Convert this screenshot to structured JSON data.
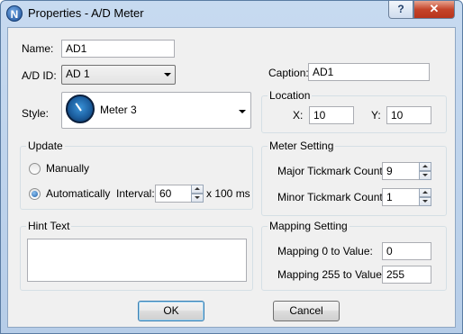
{
  "window": {
    "title": "Properties - A/D Meter",
    "app_icon_letter": "N",
    "help_label": "?",
    "close_label": "✕"
  },
  "name": {
    "label": "Name:",
    "value": "AD1"
  },
  "ad_id": {
    "label": "A/D ID:",
    "value": "AD 1"
  },
  "caption": {
    "label": "Caption:",
    "value": "AD1"
  },
  "style": {
    "label": "Style:",
    "value": "Meter 3",
    "icon": "blue-meter-gauge-icon"
  },
  "location": {
    "title": "Location",
    "x_label": "X:",
    "x_value": "10",
    "y_label": "Y:",
    "y_value": "10"
  },
  "update": {
    "title": "Update",
    "manual_label": "Manually",
    "auto_label": "Automatically",
    "selected": "Automatically",
    "interval_label": "Interval:",
    "interval_value": "60",
    "interval_unit": "x 100 ms"
  },
  "meter_setting": {
    "title": "Meter Setting",
    "major_label": "Major Tickmark Count:",
    "major_value": "9",
    "minor_label": "Minor Tickmark Count:",
    "minor_value": "1"
  },
  "hint": {
    "title": "Hint Text",
    "value": ""
  },
  "mapping": {
    "title": "Mapping Setting",
    "map0_label": "Mapping 0 to Value:",
    "map0_value": "0",
    "map255_label": "Mapping 255 to Value:",
    "map255_value": "255"
  },
  "buttons": {
    "ok": "OK",
    "cancel": "Cancel"
  }
}
